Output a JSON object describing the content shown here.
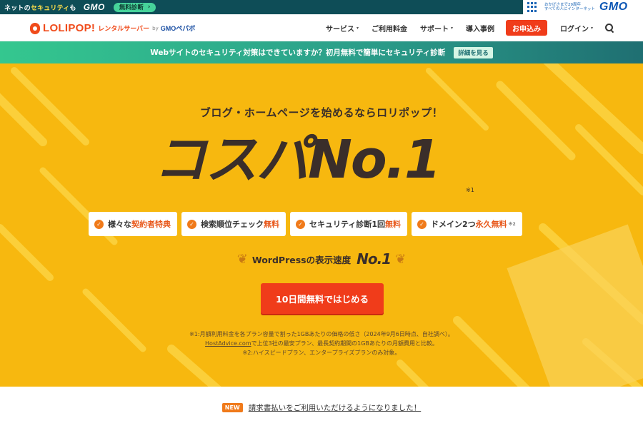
{
  "gmo_bar": {
    "tagline_prefix": "ネットの",
    "tagline_highlight": "セキュリティ",
    "tagline_suffix": "も",
    "gmo_mini": "GMO",
    "diagnosis_button": "無料診断",
    "diagnosis_arrow": "›",
    "copy_line1": "おかげさまで29周年",
    "copy_line2": "すべての人にインターネット",
    "gmo_logo": "GMO"
  },
  "header": {
    "logo_text": "LOLIPOP!",
    "logo_sub": "レンタルサーバー",
    "logo_by": "by",
    "logo_gmo": "GMOペパボ",
    "nav": [
      {
        "label": "サービス",
        "caret": "▾"
      },
      {
        "label": "ご利用料金",
        "caret": ""
      },
      {
        "label": "サポート",
        "caret": "▾"
      },
      {
        "label": "導入事例",
        "caret": ""
      }
    ],
    "signup": "お申込み",
    "login": "ログイン",
    "login_caret": "▾"
  },
  "promo": {
    "text": "Webサイトのセキュリティ対策はできていますか？初月無料で簡単にセキュリティ診断",
    "more": "詳細を見る"
  },
  "hero": {
    "subtitle": "ブログ・ホームページを始めるならロリポップ！",
    "main": "コスパNo.1",
    "main_note": "※1",
    "features": [
      {
        "pre": "様々な",
        "hl": "契約者特典",
        "post": "",
        "sup": ""
      },
      {
        "pre": "検索順位チェック",
        "hl": "無料",
        "post": "",
        "sup": ""
      },
      {
        "pre": "セキュリティ診断1回",
        "hl": "無料",
        "post": "",
        "sup": ""
      },
      {
        "pre": "ドメイン2つ",
        "hl": "永久無料",
        "post": "",
        "sup": "※2"
      }
    ],
    "check_icon": "✓",
    "wp_label": "WordPressの表示速度",
    "wp_no1": "No.1",
    "laurel_left": "❦",
    "laurel_right": "❦",
    "cta": "10日間無料ではじめる",
    "note1": "※1:月額利用料金を各プラン容量で割った1GBあたりの価格の低さ（2024年9月6日時点、自社調べ）。",
    "note2_link": "HostAdvice.com",
    "note2_rest": "で上位3社の最安プラン、最長契約期間の1GBあたりの月額費用と比較。",
    "note3": "※2:ハイスピードプラン、エンタープライズプランのみ対象。"
  },
  "news": {
    "badge": "NEW",
    "text": "請求書払いをご利用いただけるようになりました！"
  },
  "colors": {
    "hero_bg": "#f7b80f",
    "accent_red": "#f03c1a",
    "accent_orange": "#f07a1a",
    "dark_text": "#3a2e2a",
    "gmo_teal": "#0e4d57"
  }
}
